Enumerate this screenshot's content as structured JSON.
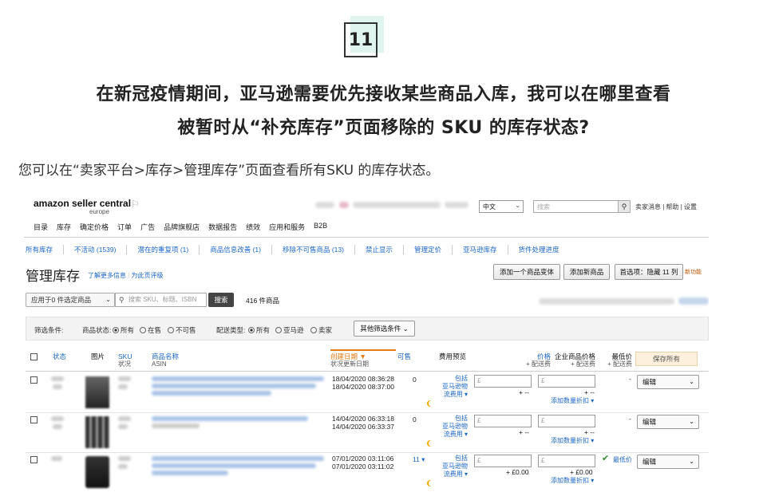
{
  "article": {
    "number": "11",
    "question_line1": "在新冠疫情期间，亚马逊需要优先接收某些商品入库，我可以在哪里查看",
    "question_line2": "被暂时从“补充库存”页面移除的 SKU 的库存状态?",
    "answer": "您可以在“卖家平台>库存>管理库存”页面查看所有SKU 的库存状态。"
  },
  "seller_central": {
    "logo": "amazon seller central",
    "logo_sub": "europe",
    "language": "中文",
    "search_placeholder": "搜索",
    "top_links": "卖家消息 | 帮助 | 设置",
    "nav": [
      "目录",
      "库存",
      "确定价格",
      "订单",
      "广告",
      "品牌旗舰店",
      "数据报告",
      "绩效",
      "应用和服务",
      "B2B"
    ],
    "subnav": [
      "所有库存",
      "不活动 (1539)",
      "潜在的重复项 (1)",
      "商品信息改善 (1)",
      "移除不可售商品 (13)",
      "禁止显示",
      "管理定价",
      "亚马逊库存",
      "货件处理进度"
    ],
    "page_title": "管理库存",
    "learn_more": "了解更多信息",
    "rate_page": "为此页评级",
    "buttons": {
      "add_variant": "添加一个商品变体",
      "add_product": "添加新商品",
      "preferences": "首选项：隐藏 11 列",
      "new_feature": "新功能"
    },
    "apply_to": "应用于0 件选定商品",
    "search_input_placeholder": "搜索 SKU、标题、ISBN",
    "search_button": "搜索",
    "product_count": "416 件商品",
    "filters": {
      "label": "筛选条件:",
      "status_label": "商品状态:",
      "status_options": [
        "所有",
        "在售",
        "不可售"
      ],
      "fulfillment_label": "配送类型:",
      "fulfillment_options": [
        "所有",
        "亚马逊",
        "卖家"
      ],
      "more": "其他筛选条件"
    },
    "columns": {
      "status": "状态",
      "image": "图片",
      "sku": "SKU",
      "sku_sub": "状况",
      "product_name": "商品名称",
      "product_name_sub": "ASIN",
      "created": "创建日期 ▼",
      "created_sub": "状况更新日期",
      "available": "可售",
      "fee_preview": "费用预览",
      "price": "价格",
      "price_sub": "+ 配送费",
      "business_price": "企业商品价格",
      "business_price_sub": "+ 配送费",
      "lowest_price": "最低价",
      "lowest_price_sub": "+ 配送费",
      "save_all": "保存所有"
    },
    "rows": [
      {
        "created": "18/04/2020 08:36:28",
        "updated": "18/04/2020 08:37:00",
        "available": "0",
        "fee_include": "包括",
        "fee_amazon": "亚马逊物",
        "fee_flow": "流费用 ▾",
        "price_dash": "+ --",
        "business_dash": "+ --",
        "add_discount": "添加数量折扣 ▾",
        "lowest": "",
        "lowest_dash": "-",
        "edit": "编辑"
      },
      {
        "created": "14/04/2020 06:33:18",
        "updated": "14/04/2020 06:33:37",
        "available": "0",
        "fee_include": "包括",
        "fee_amazon": "亚马逊物",
        "fee_flow": "流费用 ▾",
        "price_dash": "+ --",
        "business_dash": "+ --",
        "add_discount": "添加数量折扣 ▾",
        "lowest": "",
        "lowest_dash": "-",
        "edit": "编辑"
      },
      {
        "created": "07/01/2020 03:11:06",
        "updated": "07/01/2020 03:11:02",
        "available": "11 ▾",
        "fee_include": "包括",
        "fee_amazon": "亚马逊物",
        "fee_flow": "流费用 ▾",
        "price_dash": "+ £0.00",
        "business_dash": "+ £0.00",
        "add_discount": "添加数量折扣 ▾",
        "lowest": "最低价",
        "lowest_dash": "",
        "edit": "编辑"
      }
    ],
    "currency": "£"
  }
}
